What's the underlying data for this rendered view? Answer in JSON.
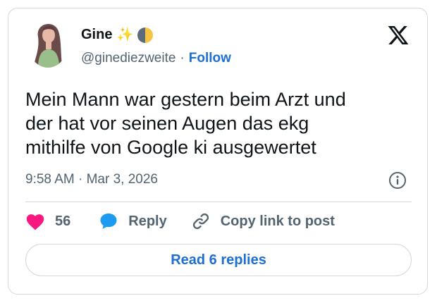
{
  "author": {
    "display_name": "Gine",
    "handle": "@ginediezweite",
    "separator": "·",
    "follow_label": "Follow",
    "name_emojis": [
      "sparkles-icon",
      "moon-icon"
    ]
  },
  "tweet": {
    "lines": [
      "Mein Mann war gestern beim Arzt und",
      "der hat vor seinen Augen das ekg",
      "mithilfe von Google ki ausgewertet"
    ],
    "timestamp": "9:58 AM · Mar 3, 2026"
  },
  "actions": {
    "like_count": "56",
    "reply_label": "Reply",
    "copy_link_label": "Copy link to post"
  },
  "read_replies_label": "Read 6 replies",
  "colors": {
    "accent": "#1d6fd1",
    "like": "#f91880",
    "reply_bubble": "#1d9bf0",
    "secondary_text": "#536471",
    "border": "#cfd9de"
  }
}
